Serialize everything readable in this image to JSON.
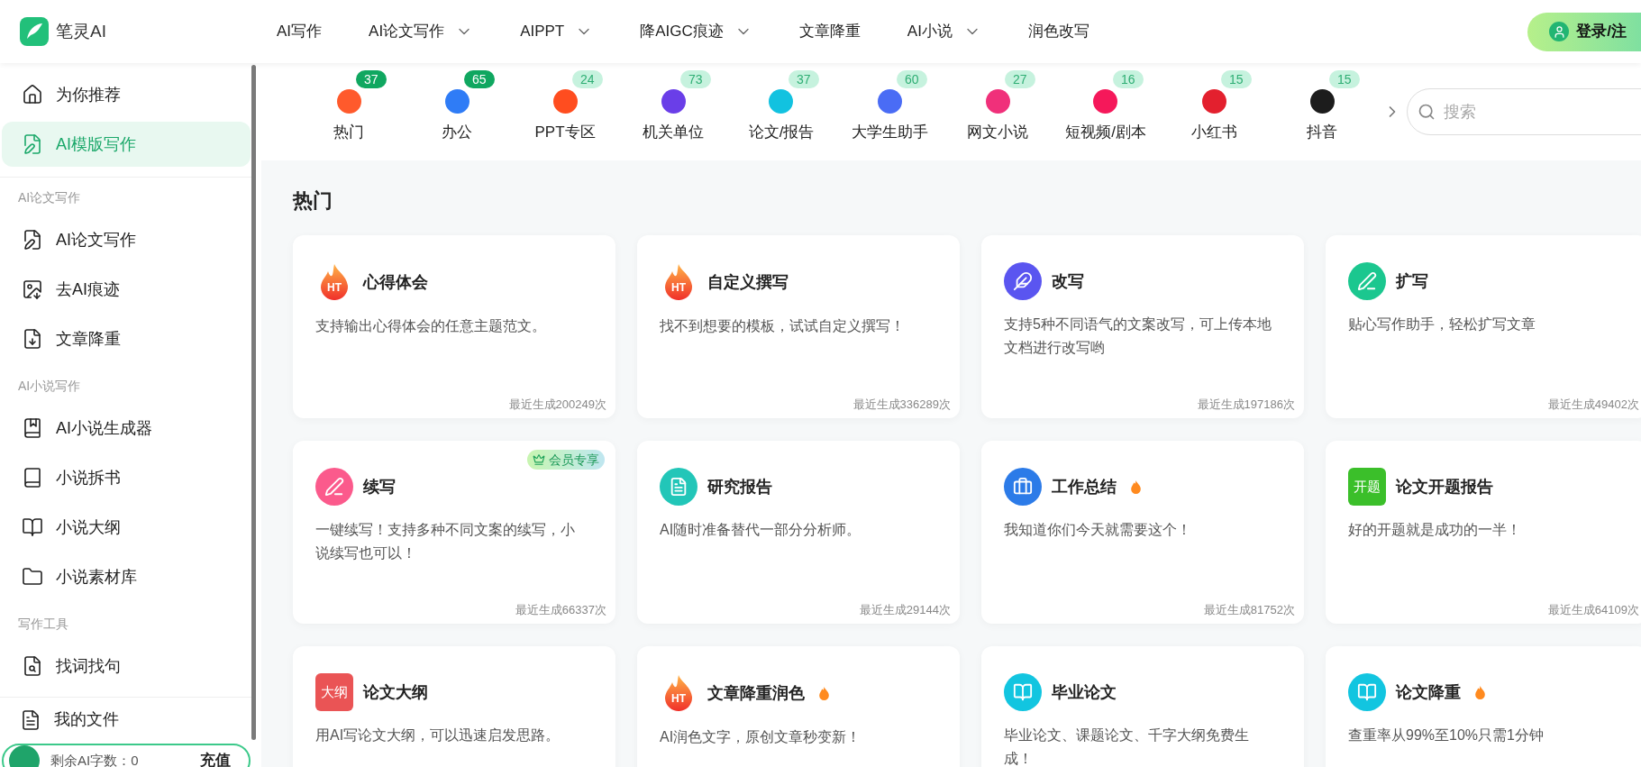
{
  "header": {
    "logo": "笔灵AI",
    "nav": [
      {
        "label": "AI写作",
        "has_menu": false
      },
      {
        "label": "AI论文写作",
        "has_menu": true
      },
      {
        "label": "AIPPT",
        "has_menu": true
      },
      {
        "label": "降AIGC痕迹",
        "has_menu": true
      },
      {
        "label": "文章降重",
        "has_menu": false
      },
      {
        "label": "AI小说",
        "has_menu": true
      },
      {
        "label": "润色改写",
        "has_menu": false
      }
    ],
    "login": "登录/注"
  },
  "sidebar": {
    "groups": [
      {
        "items": [
          {
            "label": "为你推荐",
            "selected": false
          },
          {
            "label": "AI模版写作",
            "selected": true
          }
        ]
      },
      {
        "title": "AI论文写作",
        "items": [
          {
            "label": "AI论文写作",
            "selected": false
          },
          {
            "label": "去AI痕迹",
            "selected": false
          },
          {
            "label": "文章降重",
            "selected": false
          }
        ]
      },
      {
        "title": "AI小说写作",
        "items": [
          {
            "label": "AI小说生成器",
            "selected": false
          },
          {
            "label": "小说拆书",
            "selected": false
          },
          {
            "label": "小说大纲",
            "selected": false
          },
          {
            "label": "小说素材库",
            "selected": false
          }
        ]
      },
      {
        "title": "写作工具",
        "items": [
          {
            "label": "找词找句",
            "selected": false
          }
        ]
      }
    ],
    "bottom_item": {
      "label": "我的文件",
      "selected": false
    },
    "quota": {
      "text": "剩余AI字数：0",
      "action": "充值"
    }
  },
  "categories": [
    {
      "label": "热门",
      "count": "37",
      "emphasized": true,
      "color": "#ff5a2c"
    },
    {
      "label": "办公",
      "count": "65",
      "emphasized": true,
      "color": "#2f7cf6"
    },
    {
      "label": "PPT专区",
      "count": "24",
      "emphasized": false,
      "color": "#ff4d1f"
    },
    {
      "label": "机关单位",
      "count": "73",
      "emphasized": false,
      "color": "#6a3ee8"
    },
    {
      "label": "论文/报告",
      "count": "37",
      "emphasized": false,
      "color": "#12c2e0"
    },
    {
      "label": "大学生助手",
      "count": "60",
      "emphasized": false,
      "color": "#4a6cf5"
    },
    {
      "label": "网文小说",
      "count": "27",
      "emphasized": false,
      "color": "#f0307a"
    },
    {
      "label": "短视频/剧本",
      "count": "16",
      "emphasized": false,
      "color": "#f5185a"
    },
    {
      "label": "小红书",
      "count": "15",
      "emphasized": false,
      "color": "#e3202e"
    },
    {
      "label": "抖音",
      "count": "15",
      "emphasized": false,
      "color": "#1c1c1c"
    }
  ],
  "search": {
    "placeholder": "搜索"
  },
  "section_title": "热门",
  "cards": [
    {
      "title": "心得体会",
      "icon": {
        "kind": "flame",
        "text": "HT"
      },
      "hot": false,
      "description": "支持输出心得体会的任意主题范文。",
      "count": "最近生成200249次"
    },
    {
      "title": "自定义撰写",
      "icon": {
        "kind": "flame",
        "text": "HT"
      },
      "hot": false,
      "description": "找不到想要的模板，试试自定义撰写！",
      "count": "最近生成336289次"
    },
    {
      "title": "改写",
      "icon": {
        "kind": "circle",
        "color": "#5a55f0"
      },
      "hot": false,
      "description": "支持5种不同语气的文案改写，可上传本地文档进行改写哟",
      "count": "最近生成197186次"
    },
    {
      "title": "扩写",
      "icon": {
        "kind": "circle",
        "color": "#1bc78f"
      },
      "hot": false,
      "description": "贴心写作助手，轻松扩写文章",
      "count": "最近生成49402次"
    },
    {
      "title": "续写",
      "icon": {
        "kind": "circle",
        "color": "#fb5a8c"
      },
      "hot": false,
      "badge": "会员专享",
      "description": "一键续写！支持多种不同文案的续写，小说续写也可以！",
      "count": "最近生成66337次"
    },
    {
      "title": "研究报告",
      "icon": {
        "kind": "circle",
        "color": "#22c6b8"
      },
      "hot": false,
      "description": "AI随时准备替代一部分分析师。",
      "count": "最近生成29144次"
    },
    {
      "title": "工作总结",
      "icon": {
        "kind": "circle",
        "color": "#2c7be8"
      },
      "hot": true,
      "description": "我知道你们今天就需要这个！",
      "count": "最近生成81752次"
    },
    {
      "title": "论文开题报告",
      "icon": {
        "kind": "tile",
        "text": "开题",
        "color": "#3bbf2a"
      },
      "hot": false,
      "description": "好的开题就是成功的一半！",
      "count": "最近生成64109次"
    },
    {
      "title": "论文大纲",
      "icon": {
        "kind": "tile",
        "text": "大纲",
        "color": "#ea5455"
      },
      "hot": false,
      "description": "用AI写论文大纲，可以迅速启发思路。"
    },
    {
      "title": "文章降重润色",
      "icon": {
        "kind": "flame",
        "text": "HT"
      },
      "hot": true,
      "description": "AI润色文字，原创文章秒变新！"
    },
    {
      "title": "毕业论文",
      "icon": {
        "kind": "circle",
        "color": "#12c5e0"
      },
      "hot": false,
      "description": "毕业论文、课题论文、千字大纲免费生成！"
    },
    {
      "title": "论文降重",
      "icon": {
        "kind": "circle",
        "color": "#12c5e0"
      },
      "hot": true,
      "description": "查重率从99%至10%只需1分钟"
    }
  ]
}
